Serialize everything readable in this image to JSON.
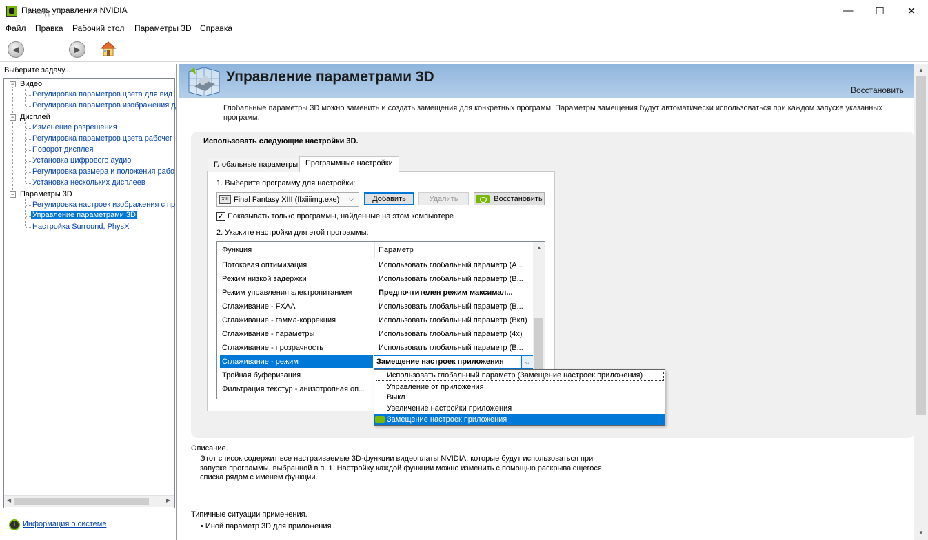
{
  "window": {
    "title": "Панель управления NVIDIA",
    "minimize": "—",
    "maximize": "☐",
    "close": "✕"
  },
  "menu": [
    {
      "label": "Файл",
      "u": "Ф",
      "rest": "айл"
    },
    {
      "label": "Правка",
      "u": "П",
      "rest": "равка"
    },
    {
      "label": "Рабочий стол",
      "u": "Р",
      "rest": "абочий стол"
    },
    {
      "label": "Параметры 3D",
      "u_prefix": "Параметры ",
      "u": "3",
      "rest": "D"
    },
    {
      "label": "Справка",
      "u": "С",
      "rest": "правка"
    }
  ],
  "toolbar": {
    "back_label": "Назад",
    "back_icon": "arrow-left-icon",
    "forward_icon": "arrow-right-icon",
    "home_icon": "home-icon"
  },
  "left": {
    "header": "Выберите задачу...",
    "tree": [
      {
        "category": "Видео",
        "items": [
          "Регулировка параметров цвета для вид",
          "Регулировка параметров изображения д"
        ]
      },
      {
        "category": "Дисплей",
        "items": [
          "Изменение разрешения",
          "Регулировка параметров цвета рабочег",
          "Поворот дисплея",
          "Установка цифрового аудио",
          "Регулировка размера и положения рабо",
          "Установка нескольких дисплеев"
        ]
      },
      {
        "category": "Параметры 3D",
        "items": [
          "Регулировка настроек изображения с пр",
          "Управление параметрами 3D",
          "Настройка Surround, PhysX"
        ]
      }
    ],
    "selected_item": "Управление параметрами 3D",
    "system_info": "Информация о системе"
  },
  "main": {
    "title": "Управление параметрами 3D",
    "restore": "Восстановить",
    "intro": "Глобальные параметры 3D можно заменить и создать замещения для конкретных программ. Параметры замещения будут автоматически использоваться при каждом запуске указанных программ.",
    "settings_title": "Использовать следующие настройки 3D.",
    "tabs": [
      "Глобальные параметры",
      "Программные настройки"
    ],
    "active_tab": "Программные настройки",
    "step1": "1. Выберите программу для настройки:",
    "program_selected": "Final Fantasy XIII (ffxiiiimg.exe)",
    "program_icon_text": "XIII",
    "add_button": "Добавить",
    "remove_button": "Удалить",
    "restore_button": "Восстановить",
    "show_only_checked": true,
    "show_only_label": "Показывать только программы, найденные на этом компьютере",
    "step2": "2. Укажите настройки для этой программы:",
    "columns": [
      "Функция",
      "Параметр"
    ],
    "rows": [
      {
        "func": "Потоковая оптимизация",
        "param": "Использовать глобальный параметр (А..."
      },
      {
        "func": "Режим низкой задержки",
        "param": "Использовать глобальный параметр (В..."
      },
      {
        "func": "Режим управления электропитанием",
        "param": "Предпочтителен режим максимал...",
        "bold": true
      },
      {
        "func": "Сглаживание - FXAA",
        "param": "Использовать глобальный параметр (В..."
      },
      {
        "func": "Сглаживание - гамма-коррекция",
        "param": "Использовать глобальный параметр (Вкл)"
      },
      {
        "func": "Сглаживание - параметры",
        "param": "Использовать глобальный параметр (4x)"
      },
      {
        "func": "Сглаживание - прозрачность",
        "param": "Использовать глобальный параметр (В..."
      },
      {
        "func": "Сглаживание - режим",
        "param": "Замещение настроек приложения",
        "bold": true,
        "selected": true
      },
      {
        "func": "Тройная буферизация",
        "param": ""
      },
      {
        "func": "Фильтрация текстур - анизотропная оп...",
        "param": ""
      }
    ],
    "dropdown_options": [
      "Использовать глобальный параметр (Замещение настроек приложения)",
      "Управление от приложения",
      "Выкл",
      "Увеличение настройки приложения",
      "Замещение настроек приложения"
    ],
    "dropdown_selected": "Замещение настроек приложения",
    "description_label": "Описание.",
    "description": "Этот список содержит все настраиваемые 3D-функции видеоплаты NVIDIA, которые будут использоваться при запуске программы, выбранной в п. 1. Настройку каждой функции можно изменить с помощью раскрывающегося списка рядом с именем функции.",
    "usage_label": "Типичные ситуации применения.",
    "usage_items": [
      "Иной параметр 3D для приложения"
    ]
  }
}
